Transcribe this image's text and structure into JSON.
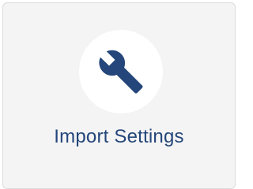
{
  "tile": {
    "label": "Import Settings",
    "icon": "wrench-icon"
  },
  "colors": {
    "accent": "#24467a",
    "tile_background": "#f4f4f4",
    "icon_circle": "#ffffff",
    "border": "#dcdcdc"
  }
}
